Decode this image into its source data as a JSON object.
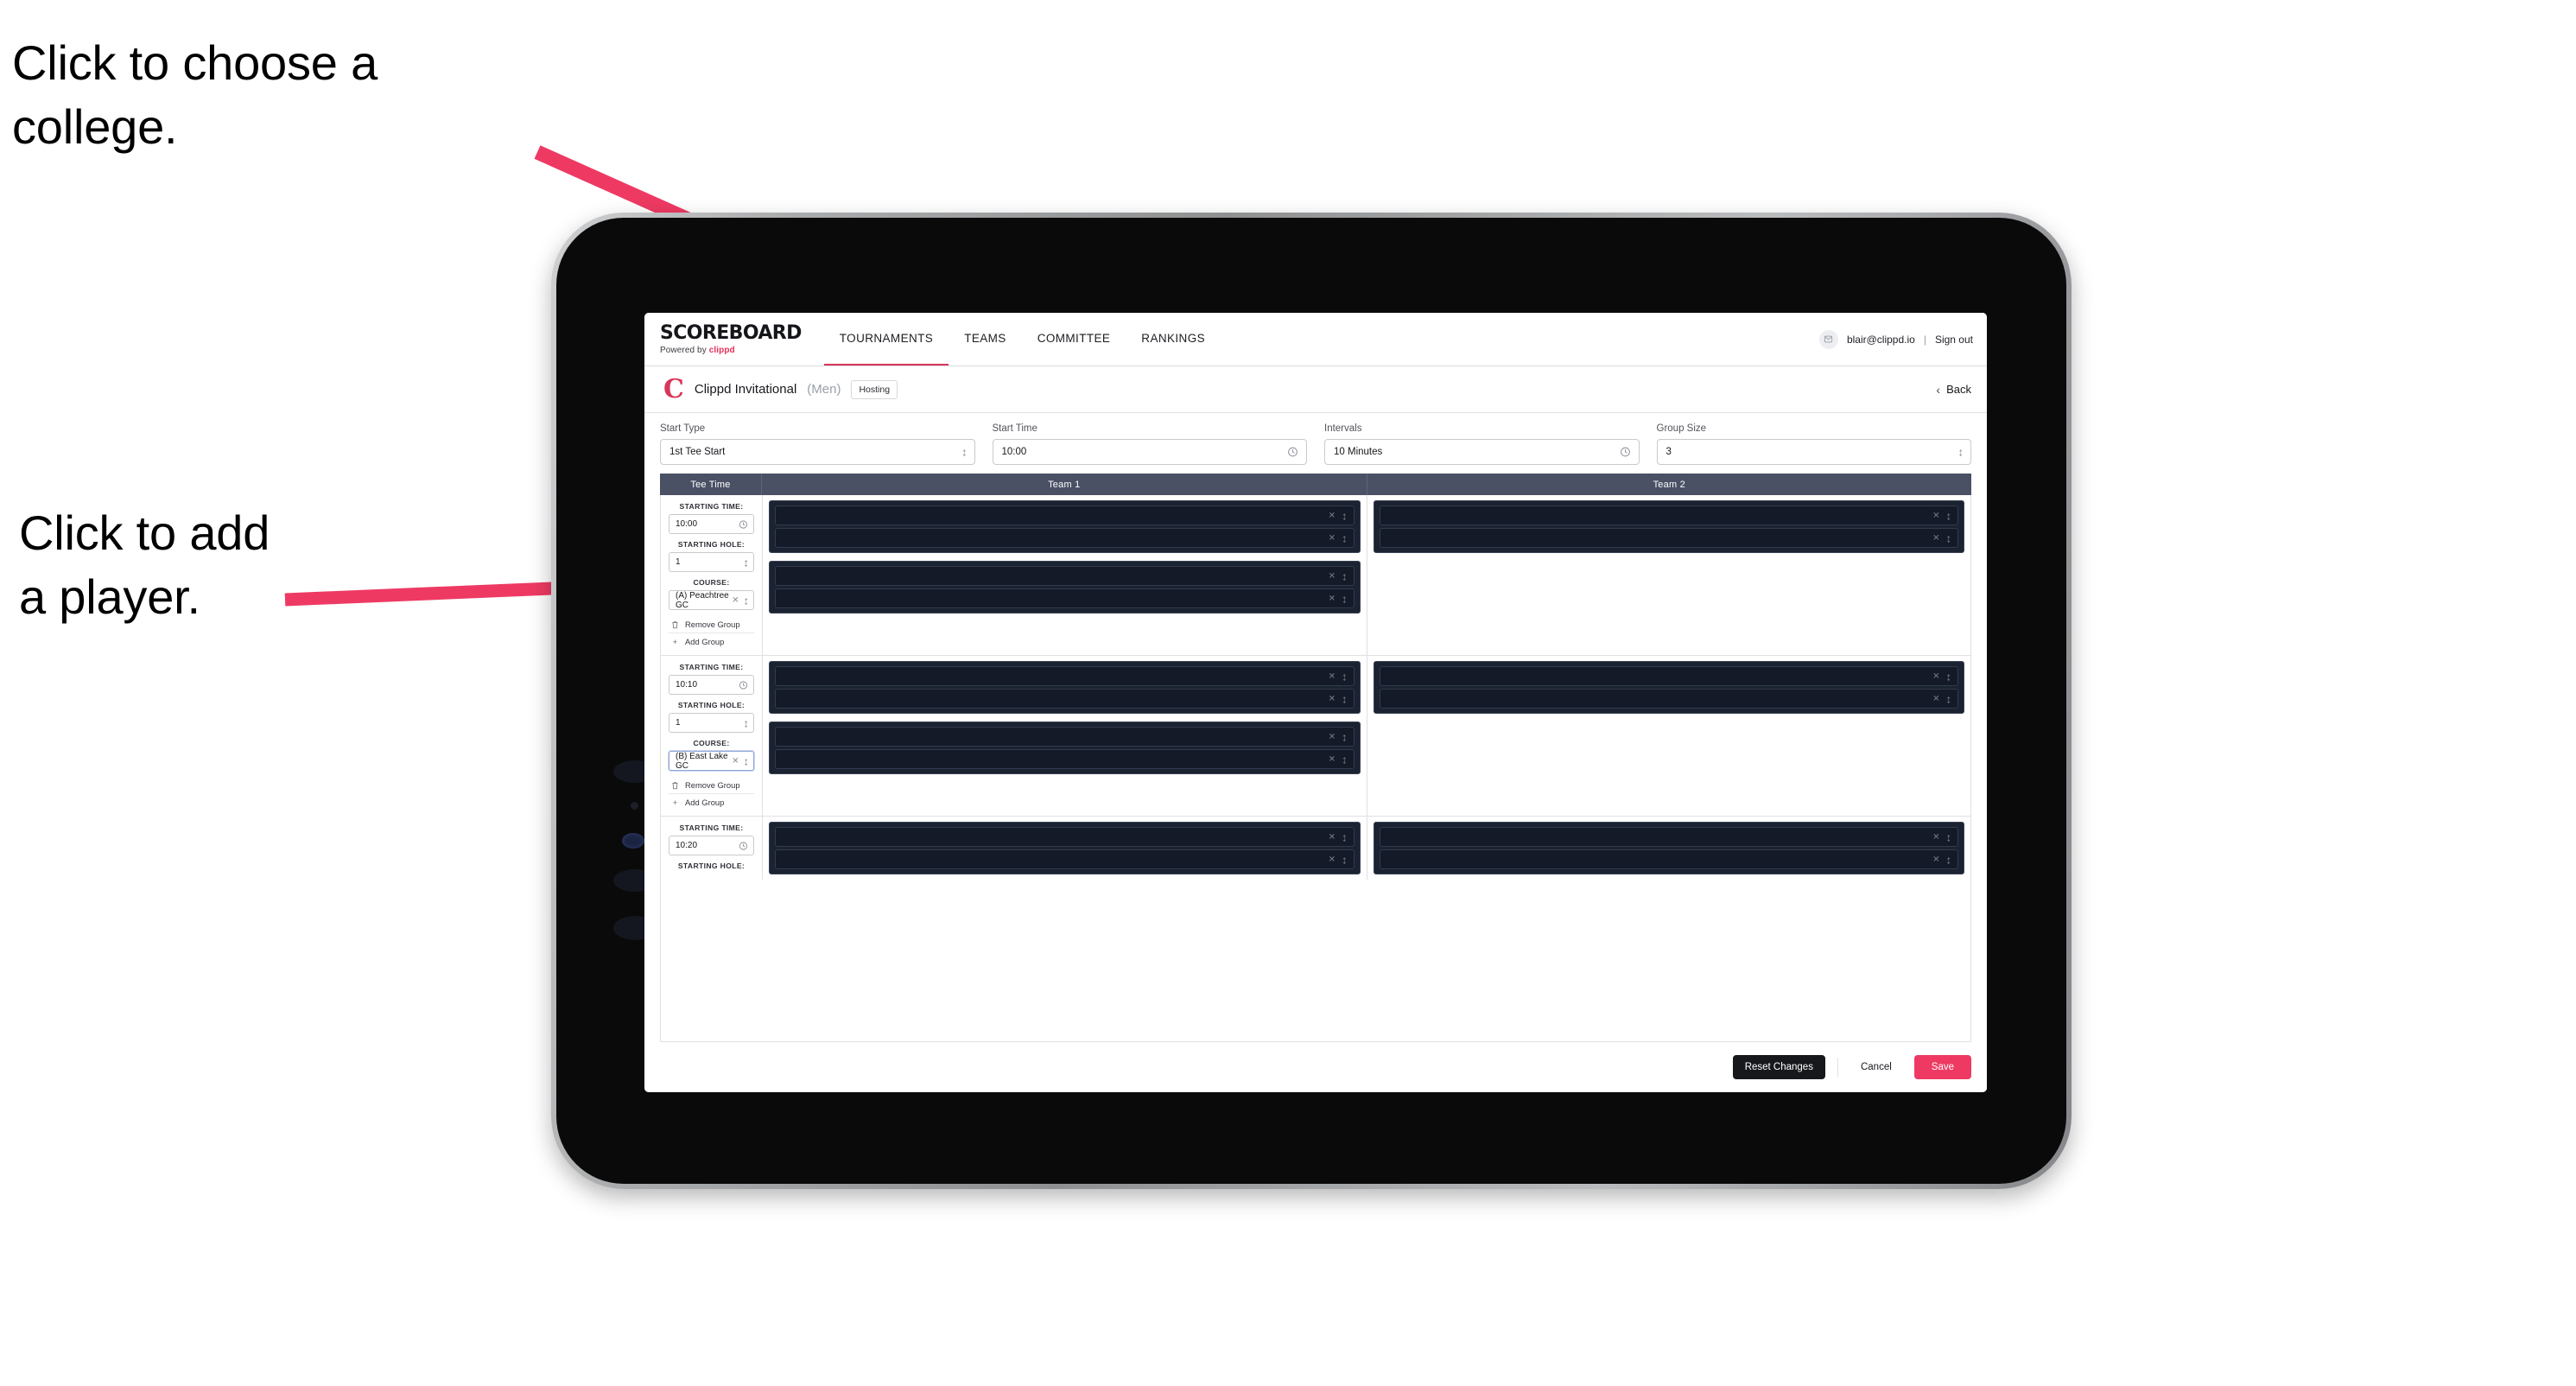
{
  "annotations": [
    {
      "id": "choose-college",
      "text": "Click to choose a\ncollege."
    },
    {
      "id": "add-player",
      "text": "Click to add\na player."
    }
  ],
  "colors": {
    "accent_pink": "#ee3a63",
    "brand_red": "#d8365c",
    "table_header": "#4a5165",
    "panel_dark": "#1b2231",
    "row_dark": "#141a27"
  },
  "app": {
    "brand": {
      "title": "SCOREBOARD",
      "sub_prefix": "Powered by ",
      "sub_accent": "clippd"
    },
    "nav": [
      {
        "label": "TOURNAMENTS",
        "active": true
      },
      {
        "label": "TEAMS",
        "active": false
      },
      {
        "label": "COMMITTEE",
        "active": false
      },
      {
        "label": "RANKINGS",
        "active": false
      }
    ],
    "account": {
      "avatar_icon": "user-icon",
      "email": "blair@clippd.io",
      "separator": "|",
      "sign_out": "Sign out"
    },
    "tournament": {
      "logo_letter": "C",
      "name": "Clippd Invitational",
      "gender": "(Men)",
      "status_badge": "Hosting",
      "back_label": "Back",
      "back_icon": "chevron-left-icon"
    },
    "controls": [
      {
        "label": "Start Type",
        "value": "1st Tee Start",
        "icon": "spinner-icon"
      },
      {
        "label": "Start Time",
        "value": "10:00",
        "icon": "clock-icon"
      },
      {
        "label": "Intervals",
        "value": "10 Minutes",
        "icon": "clock-icon"
      },
      {
        "label": "Group Size",
        "value": "3",
        "icon": "spinner-icon"
      }
    ],
    "table": {
      "headers": [
        "Tee Time",
        "Team 1",
        "Team 2"
      ],
      "field_labels": {
        "starting_time": "STARTING TIME:",
        "starting_hole": "STARTING HOLE:",
        "course": "COURSE:"
      },
      "actions": {
        "remove_group": "Remove Group",
        "remove_icon": "trash-icon",
        "add_group": "Add Group",
        "add_icon": "plus-icon"
      },
      "groups": [
        {
          "starting_time": "10:00",
          "starting_hole": "1",
          "course": "(A) Peachtree GC",
          "course_focused": false,
          "team1_panels": [
            {
              "rows": [
                "",
                ""
              ]
            },
            {
              "rows": [
                "",
                ""
              ]
            }
          ],
          "team2_panels": [
            {
              "rows": [
                "",
                ""
              ]
            }
          ]
        },
        {
          "starting_time": "10:10",
          "starting_hole": "1",
          "course": "(B) East Lake GC",
          "course_focused": true,
          "team1_panels": [
            {
              "rows": [
                "",
                ""
              ]
            },
            {
              "rows": [
                "",
                ""
              ]
            }
          ],
          "team2_panels": [
            {
              "rows": [
                "",
                ""
              ]
            }
          ]
        },
        {
          "starting_time": "10:20",
          "starting_hole": "",
          "course": "",
          "course_focused": false,
          "team1_panels": [
            {
              "rows": [
                "",
                ""
              ]
            }
          ],
          "team2_panels": [
            {
              "rows": [
                "",
                ""
              ]
            }
          ]
        }
      ]
    },
    "footer": {
      "reset": "Reset Changes",
      "cancel": "Cancel",
      "save": "Save"
    }
  }
}
